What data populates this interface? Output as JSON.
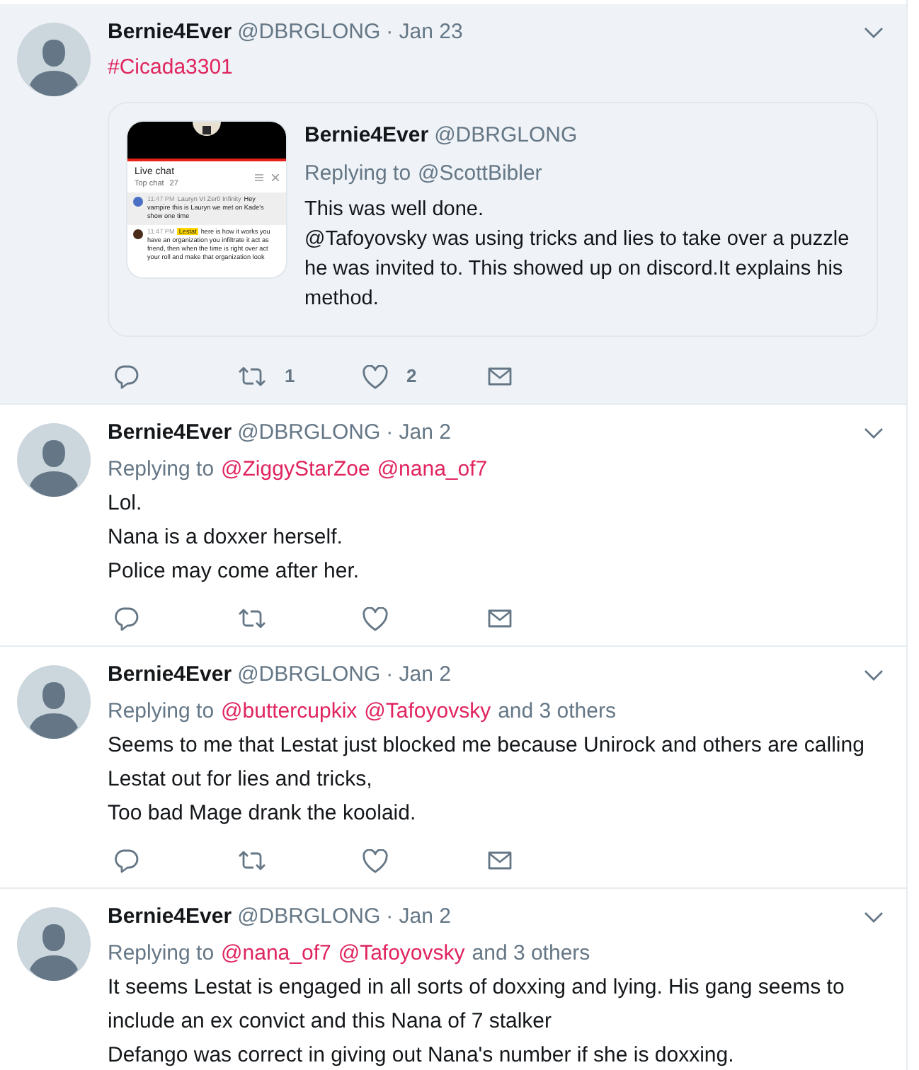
{
  "tweets": [
    {
      "highlighted": true,
      "author": "Bernie4Ever",
      "handle": "@DBRGLONG",
      "date": "· Jan 23",
      "body": [
        {
          "kind": "link",
          "text": "#Cicada3301"
        }
      ],
      "quote": {
        "author": "Bernie4Ever",
        "handle": "@DBRGLONG",
        "replying_label": "Replying to",
        "replying_to": "@ScottBibler",
        "body": [
          "This was well done.",
          "@Tafoyovsky was using tricks and lies to take over a puzzle he was invited to. This showed up on discord.It explains his method."
        ],
        "thumbnail": {
          "title": "Live chat",
          "subtitle": "Top chat",
          "viewers": "27",
          "messages": [
            {
              "time": "11:47 PM",
              "author": "Lauryn VI Zer0 Infinity",
              "highlighted_author": false,
              "text": "Hey vampire this is Lauryn we met on Kade's show one time",
              "shaded": true,
              "color": "#4a6fc4"
            },
            {
              "time": "11:47 PM",
              "author": "Lestat",
              "highlighted_author": true,
              "text": "here is how it works you have an organization you infiltrate it act as friend, then when the time is right over act your roll and make that organization look",
              "shaded": false,
              "color": "#4a2c1a"
            }
          ]
        }
      },
      "actions": true,
      "retweets": "1",
      "likes": "2"
    },
    {
      "highlighted": false,
      "author": "Bernie4Ever",
      "handle": "@DBRGLONG",
      "date": "· Jan 2",
      "replying_label": "Replying to",
      "mentions": [
        "@ZiggyStarZoe",
        "@nana_of7"
      ],
      "actions": true,
      "body": [
        {
          "kind": "text",
          "text": "Lol."
        },
        {
          "kind": "text",
          "text": "Nana is a doxxer herself."
        },
        {
          "kind": "text",
          "text": "Police may come after her."
        }
      ]
    },
    {
      "highlighted": false,
      "author": "Bernie4Ever",
      "handle": "@DBRGLONG",
      "date": "· Jan 2",
      "replying_label": "Replying to",
      "mentions": [
        "@buttercupkix",
        "@Tafoyovsky"
      ],
      "others": "and 3 others",
      "actions": true,
      "body": [
        {
          "kind": "text",
          "text": "Seems to me that Lestat just blocked me because Unirock and others are calling Lestat out for lies and tricks,"
        },
        {
          "kind": "text",
          "text": "Too bad Mage drank the koolaid."
        }
      ]
    },
    {
      "highlighted": false,
      "author": "Bernie4Ever",
      "handle": "@DBRGLONG",
      "date": "· Jan 2",
      "replying_label": "Replying to",
      "mentions": [
        "@nana_of7",
        "@Tafoyovsky"
      ],
      "others": "and 3 others",
      "body": [
        {
          "kind": "text",
          "text": "It seems Lestat is engaged in all sorts of doxxing and lying. His gang seems to include an ex convict and this Nana of 7 stalker"
        },
        {
          "kind": "text",
          "text": "Defango was correct in giving out Nana's number if she is doxxing."
        }
      ]
    }
  ]
}
